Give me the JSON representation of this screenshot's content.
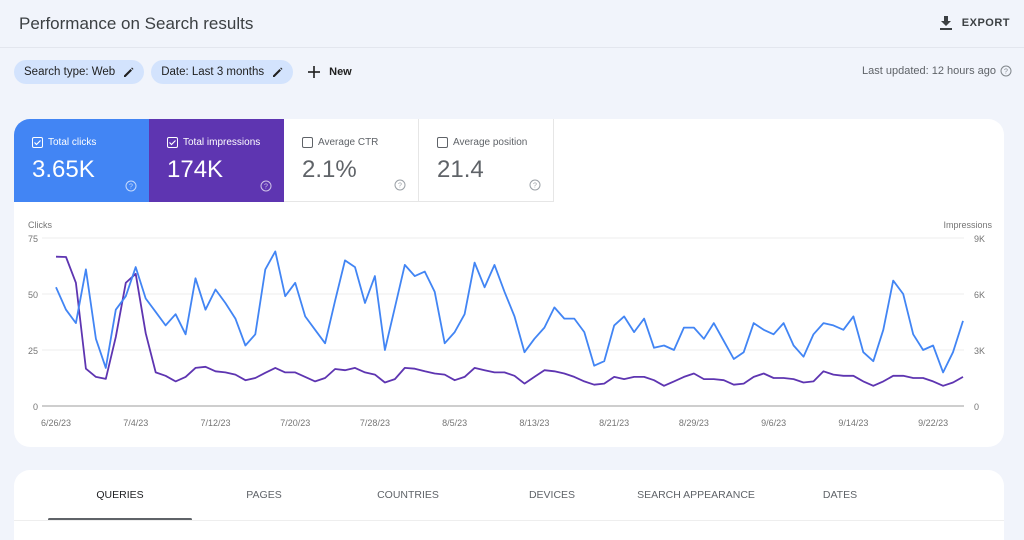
{
  "header": {
    "title": "Performance on Search results",
    "export_label": "EXPORT"
  },
  "filters": {
    "chips": [
      {
        "label": "Search type: Web"
      },
      {
        "label": "Date: Last 3 months"
      }
    ],
    "new_label": "New",
    "last_updated": "Last updated: 12 hours ago"
  },
  "metrics": [
    {
      "label": "Total clicks",
      "value": "3.65K",
      "checked": true,
      "color": "#4285f4"
    },
    {
      "label": "Total impressions",
      "value": "174K",
      "checked": true,
      "color": "#5e35b1"
    },
    {
      "label": "Average CTR",
      "value": "2.1%",
      "checked": false
    },
    {
      "label": "Average position",
      "value": "21.4",
      "checked": false
    }
  ],
  "chart_data": {
    "type": "line",
    "left_axis": {
      "label": "Clicks",
      "ticks": [
        "0",
        "25",
        "50",
        "75"
      ],
      "range": [
        0,
        75
      ]
    },
    "right_axis": {
      "label": "Impressions",
      "ticks": [
        "0",
        "3K",
        "6K",
        "9K"
      ],
      "range": [
        0,
        9000
      ]
    },
    "x_ticks": [
      "6/26/23",
      "7/4/23",
      "7/12/23",
      "7/20/23",
      "7/28/23",
      "8/5/23",
      "8/13/23",
      "8/21/23",
      "8/29/23",
      "9/6/23",
      "9/14/23",
      "9/22/23"
    ],
    "x_start": "6/26/23",
    "grid": true,
    "series": [
      {
        "name": "Total clicks",
        "axis": "left",
        "color": "#4285f4",
        "values": [
          53,
          43,
          37,
          61,
          30,
          17,
          43,
          49,
          62,
          48,
          42,
          36,
          41,
          32,
          57,
          43,
          52,
          46,
          39,
          27,
          32,
          61,
          69,
          49,
          55,
          40,
          34,
          28,
          47,
          65,
          62,
          46,
          58,
          25,
          44,
          63,
          58,
          60,
          51,
          28,
          33,
          41,
          64,
          53,
          63,
          51,
          40,
          24,
          30,
          35,
          44,
          39,
          39,
          33,
          18,
          20,
          36,
          40,
          33,
          39,
          26,
          27,
          25,
          35,
          35,
          30,
          37,
          29,
          21,
          24,
          37,
          34,
          32,
          37,
          27,
          22,
          32,
          37,
          36,
          34,
          40,
          24,
          20,
          34,
          56,
          50,
          32,
          25,
          27,
          15,
          24,
          38
        ]
      },
      {
        "name": "Total impressions",
        "axis": "right",
        "color": "#5e35b1",
        "values": [
          8000,
          7980,
          6600,
          2000,
          1560,
          1450,
          3700,
          6600,
          7080,
          3900,
          1800,
          1620,
          1320,
          1560,
          2040,
          2100,
          1860,
          1800,
          1680,
          1380,
          1500,
          1780,
          2040,
          1800,
          1800,
          1560,
          1320,
          1500,
          1980,
          1920,
          2040,
          1800,
          1680,
          1260,
          1440,
          2040,
          2000,
          1860,
          1740,
          1680,
          1380,
          1560,
          2040,
          1920,
          1800,
          1800,
          1620,
          1200,
          1560,
          1920,
          1860,
          1740,
          1560,
          1320,
          1140,
          1200,
          1560,
          1440,
          1560,
          1560,
          1380,
          1080,
          1320,
          1560,
          1740,
          1440,
          1440,
          1380,
          1140,
          1200,
          1560,
          1740,
          1500,
          1500,
          1440,
          1260,
          1320,
          1860,
          1680,
          1620,
          1620,
          1320,
          1080,
          1320,
          1620,
          1620,
          1500,
          1500,
          1320,
          1080,
          1260,
          1560
        ]
      }
    ]
  },
  "tabs": [
    {
      "label": "QUERIES",
      "active": true
    },
    {
      "label": "PAGES"
    },
    {
      "label": "COUNTRIES"
    },
    {
      "label": "DEVICES"
    },
    {
      "label": "SEARCH APPEARANCE"
    },
    {
      "label": "DATES"
    }
  ]
}
